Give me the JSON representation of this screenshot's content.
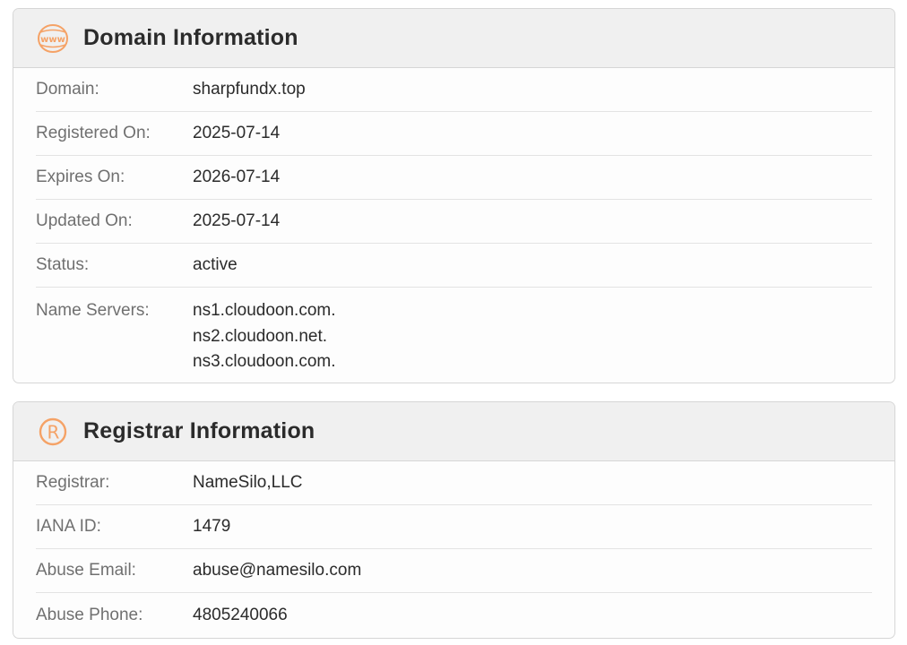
{
  "domain_card": {
    "title": "Domain Information",
    "icon": "www-globe-icon",
    "rows": [
      {
        "label": "Domain:",
        "value": "sharpfundx.top"
      },
      {
        "label": "Registered On:",
        "value": "2025-07-14"
      },
      {
        "label": "Expires On:",
        "value": "2026-07-14"
      },
      {
        "label": "Updated On:",
        "value": "2025-07-14"
      },
      {
        "label": "Status:",
        "value": "active"
      }
    ],
    "name_servers": {
      "label": "Name Servers:",
      "values": [
        "ns1.cloudoon.com.",
        "ns2.cloudoon.net.",
        "ns3.cloudoon.com."
      ]
    }
  },
  "registrar_card": {
    "title": "Registrar Information",
    "icon": "registered-mark-icon",
    "rows": [
      {
        "label": "Registrar:",
        "value": "NameSilo,LLC"
      },
      {
        "label": "IANA ID:",
        "value": "1479"
      },
      {
        "label": "Abuse Email:",
        "value": "abuse@namesilo.com"
      },
      {
        "label": "Abuse Phone:",
        "value": "4805240066"
      }
    ]
  },
  "colors": {
    "accent": "#f5a266",
    "header_bg": "#f0f0f0",
    "label": "#707070",
    "value": "#2b2b2b"
  }
}
